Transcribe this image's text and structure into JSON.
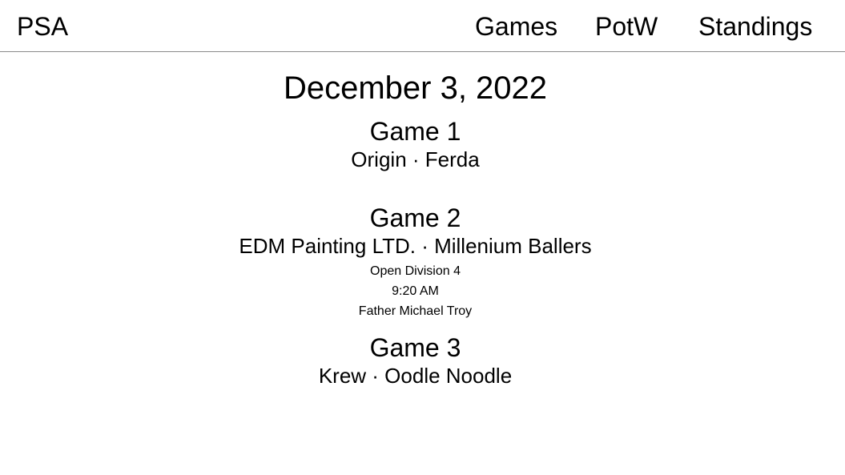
{
  "nav": {
    "brand": "PSA",
    "links": [
      {
        "label": "Games"
      },
      {
        "label": "PotW"
      },
      {
        "label": "Standings"
      }
    ]
  },
  "main": {
    "date": "December 3, 2022",
    "games": [
      {
        "title": "Game 1",
        "teams": "Origin · Ferda"
      },
      {
        "title": "Game 2",
        "teams": "EDM Painting LTD. · Millenium Ballers",
        "division": "Open Division 4",
        "time": "9:20 AM",
        "location": "Father Michael Troy"
      },
      {
        "title": "Game 3",
        "teams": "Krew · Oodle Noodle"
      }
    ]
  }
}
